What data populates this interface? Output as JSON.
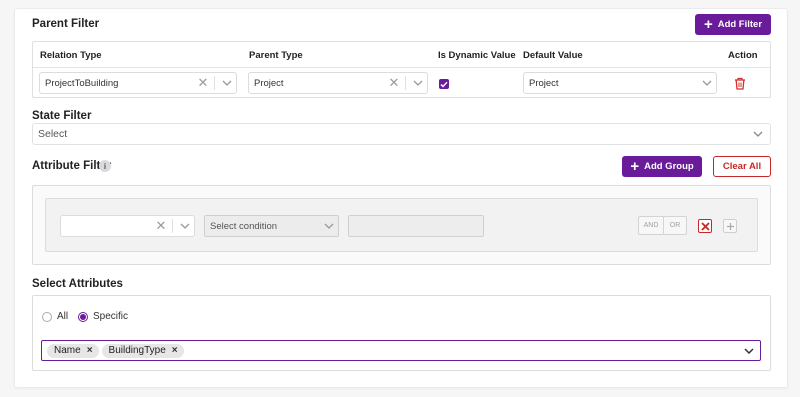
{
  "parent_filter": {
    "title": "Parent Filter",
    "add_button": "Add Filter",
    "columns": [
      "Relation Type",
      "Parent Type",
      "Is Dynamic Value",
      "Default Value",
      "Action"
    ],
    "row": {
      "relation_type": "ProjectToBuilding",
      "parent_type": "Project",
      "is_dynamic": true,
      "default_value": "Project"
    }
  },
  "state_filter": {
    "title": "State Filter",
    "placeholder": "Select"
  },
  "attribute_filter": {
    "title": "Attribute Filter",
    "info_icon": "info-icon",
    "add_group_button": "Add Group",
    "clear_all_button": "Clear All",
    "condition_placeholder": "Select condition",
    "and_label": "AND",
    "or_label": "OR"
  },
  "select_attributes": {
    "title": "Select Attributes",
    "options": [
      "All",
      "Specific"
    ],
    "selected": "Specific",
    "tags": [
      "Name",
      "BuildingType"
    ]
  },
  "colors": {
    "accent": "#6a1b9a",
    "danger": "#c62828"
  }
}
